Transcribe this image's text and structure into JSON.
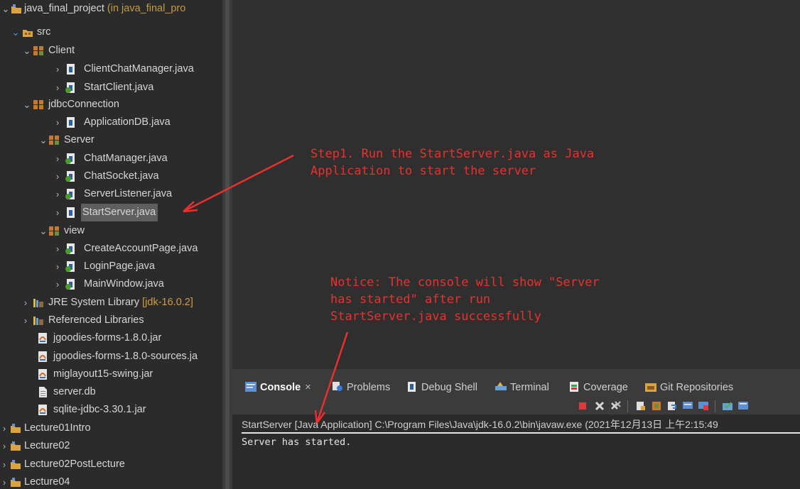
{
  "explorer": {
    "project": {
      "name": "java_final_project",
      "suffix": " (in java_final_pro"
    },
    "src": "src",
    "packages": [
      {
        "name": "Client",
        "files": [
          "ClientChatManager.java",
          "StartClient.java"
        ]
      },
      {
        "name": "jdbcConnection",
        "files": [
          "ApplicationDB.java"
        ]
      },
      {
        "name": "Server",
        "files": [
          "ChatManager.java",
          "ChatSocket.java",
          "ServerListener.java",
          "StartServer.java"
        ]
      },
      {
        "name": "view",
        "files": [
          "CreateAccountPage.java",
          "LoginPage.java",
          "MainWindow.java"
        ]
      }
    ],
    "jre": {
      "name": "JRE System Library ",
      "suffix": "[jdk-16.0.2]"
    },
    "referenced": "Referenced Libraries",
    "jars": [
      "jgoodies-forms-1.8.0.jar",
      "jgoodies-forms-1.8.0-sources.ja",
      "miglayout15-swing.jar"
    ],
    "db": "server.db",
    "jar_last": "sqlite-jdbc-3.30.1.jar",
    "other_projects": [
      "Lecture01Intro",
      "Lecture02",
      "Lecture02PostLecture",
      "Lecture04"
    ],
    "selected": "StartServer.java"
  },
  "annotations": {
    "step1": "Step1. Run the StartServer.java as Java\nApplication to start the server",
    "notice": "Notice: The console will show \"Server\nhas started\" after run\nStartServer.java successfully"
  },
  "console": {
    "tabs": [
      {
        "label": "Console",
        "icon": "console-icon",
        "active": true,
        "close": "×"
      },
      {
        "label": "Problems",
        "icon": "problems-icon"
      },
      {
        "label": "Debug Shell",
        "icon": "debug-shell-icon"
      },
      {
        "label": "Terminal",
        "icon": "terminal-icon"
      },
      {
        "label": "Coverage",
        "icon": "coverage-icon"
      },
      {
        "label": "Git Repositories",
        "icon": "git-repositories-icon"
      }
    ],
    "process_line": "StartServer [Java Application] C:\\Program Files\\Java\\jdk-16.0.2\\bin\\javaw.exe  (2021年12月13日 上午2:15:49",
    "output": "Server has started."
  },
  "colors": {
    "annotation": "#e8312f",
    "background": "#2b2b2b",
    "selection": "#5e5e5e"
  }
}
